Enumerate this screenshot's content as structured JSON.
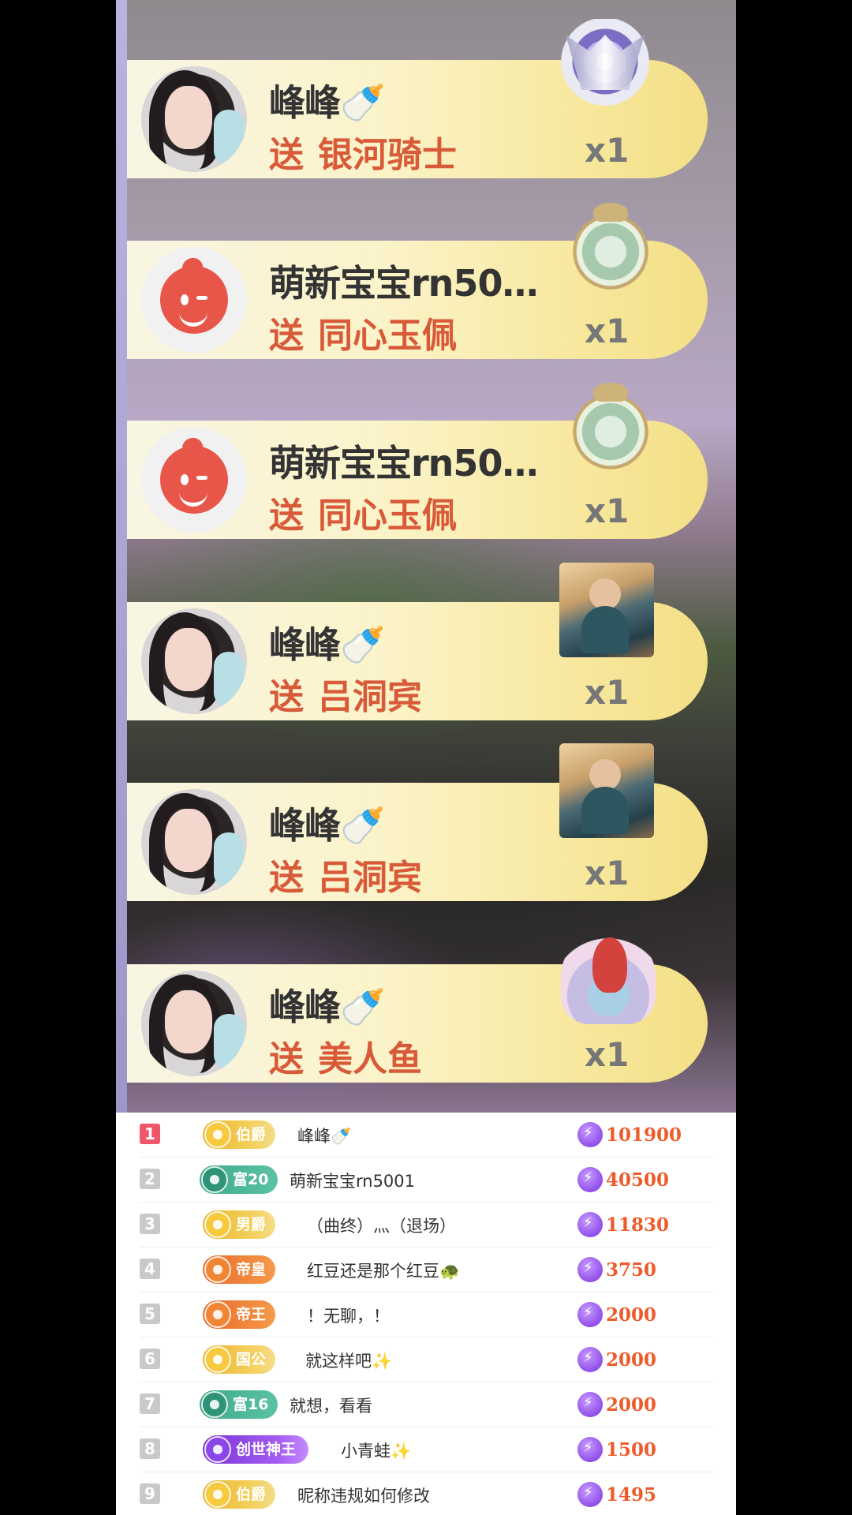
{
  "gift_feed": [
    {
      "sender": "峰峰🍼",
      "verb": "送",
      "gift_name": "银河骑士",
      "count": "x1",
      "avatar_icon": "girl-avatar",
      "gift_icon": "galaxy-knight-armor-icon"
    },
    {
      "sender": "萌新宝宝rn50…",
      "verb": "送",
      "gift_name": "同心玉佩",
      "count": "x1",
      "avatar_icon": "kuaishou-mascot-avatar",
      "gift_icon": "jade-pendant-icon"
    },
    {
      "sender": "萌新宝宝rn50…",
      "verb": "送",
      "gift_name": "同心玉佩",
      "count": "x1",
      "avatar_icon": "kuaishou-mascot-avatar",
      "gift_icon": "jade-pendant-icon"
    },
    {
      "sender": "峰峰🍼",
      "verb": "送",
      "gift_name": "吕洞宾",
      "count": "x1",
      "avatar_icon": "girl-avatar",
      "gift_icon": "lv-dongbin-icon"
    },
    {
      "sender": "峰峰🍼",
      "verb": "送",
      "gift_name": "吕洞宾",
      "count": "x1",
      "avatar_icon": "girl-avatar",
      "gift_icon": "lv-dongbin-icon"
    },
    {
      "sender": "峰峰🍼",
      "verb": "送",
      "gift_name": "美人鱼",
      "count": "x1",
      "avatar_icon": "girl-avatar",
      "gift_icon": "mermaid-icon"
    }
  ],
  "ranking": [
    {
      "rank": "1",
      "level": "伯爵",
      "level_style": "gold",
      "name": "峰峰🍼",
      "score": "101900"
    },
    {
      "rank": "2",
      "level": "富20",
      "level_style": "teal",
      "name": "萌新宝宝rn5001",
      "score": "40500"
    },
    {
      "rank": "3",
      "level": "男爵",
      "level_style": "gold",
      "name": "（曲终）灬（退场）",
      "score": "11830"
    },
    {
      "rank": "4",
      "level": "帝皇",
      "level_style": "orange",
      "name": "红豆还是那个红豆🐢",
      "score": "3750"
    },
    {
      "rank": "5",
      "level": "帝王",
      "level_style": "orange",
      "name": "！无聊，！",
      "score": "2000"
    },
    {
      "rank": "6",
      "level": "国公",
      "level_style": "gold",
      "name": "就这样吧✨",
      "score": "2000"
    },
    {
      "rank": "7",
      "level": "富16",
      "level_style": "teal",
      "name": "就想，看看",
      "score": "2000"
    },
    {
      "rank": "8",
      "level": "创世神王",
      "level_style": "purple",
      "name": "小青蛙✨",
      "score": "1500"
    },
    {
      "rank": "9",
      "level": "伯爵",
      "level_style": "gold",
      "name": "昵称违规如何修改",
      "score": "1495"
    }
  ],
  "colors": {
    "gift_text": "#d85a39",
    "score_text": "#ee5b2a",
    "rank_first": "#f0566a",
    "card_gradient_end": "#f3df86"
  }
}
